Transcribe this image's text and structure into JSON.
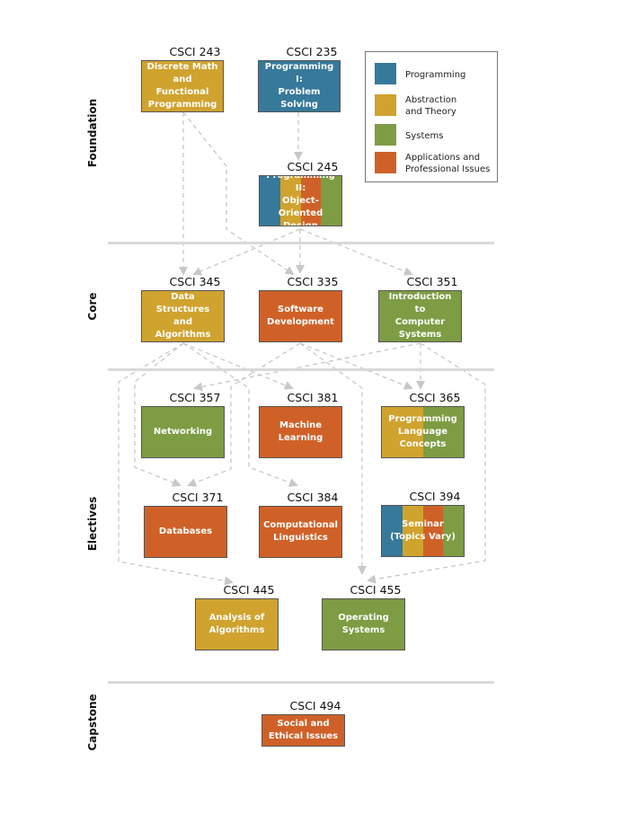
{
  "colors": {
    "programming": "#36799a",
    "abstraction": "#d0a32f",
    "systems": "#7d9c43",
    "applications": "#cf6128",
    "arrow": "#c8c8c8",
    "divider": "#d9d9d9"
  },
  "legend": [
    {
      "category": "programming",
      "label": "Programming"
    },
    {
      "category": "abstraction",
      "label": "Abstraction\nand Theory"
    },
    {
      "category": "systems",
      "label": "Systems"
    },
    {
      "category": "applications",
      "label": "Applications and\nProfessional Issues"
    }
  ],
  "sections": [
    {
      "id": "foundation",
      "label": "Foundation"
    },
    {
      "id": "core",
      "label": "Core"
    },
    {
      "id": "electives",
      "label": "Electives"
    },
    {
      "id": "capstone",
      "label": "Capstone"
    }
  ],
  "courses": [
    {
      "id": "243",
      "code": "CSCI 243",
      "title": "Discrete Math\nand Functional\nProgramming",
      "categories": [
        "abstraction"
      ],
      "section": "foundation"
    },
    {
      "id": "235",
      "code": "CSCI 235",
      "title": "Programming I:\nProblem Solving",
      "categories": [
        "programming"
      ],
      "section": "foundation"
    },
    {
      "id": "245",
      "code": "CSCI  245",
      "title": "Programming II:\nObject-Oriented\nDesign",
      "categories": [
        "programming",
        "abstraction",
        "applications",
        "systems"
      ],
      "section": "foundation"
    },
    {
      "id": "345",
      "code": "CSCI 345",
      "title": "Data Structures\nand\nAlgorithms",
      "categories": [
        "abstraction"
      ],
      "section": "core"
    },
    {
      "id": "335",
      "code": "CSCI 335",
      "title": "Software\nDevelopment",
      "categories": [
        "applications"
      ],
      "section": "core"
    },
    {
      "id": "351",
      "code": "CSCI 351",
      "title": "Introduction to\nComputer\nSystems",
      "categories": [
        "systems"
      ],
      "section": "core"
    },
    {
      "id": "357",
      "code": "CSCI 357",
      "title": "Networking",
      "categories": [
        "systems"
      ],
      "section": "electives"
    },
    {
      "id": "381",
      "code": "CSCI 381",
      "title": "Machine\nLearning",
      "categories": [
        "applications"
      ],
      "section": "electives"
    },
    {
      "id": "365",
      "code": "CSCI 365",
      "title": "Programming\nLanguage\nConcepts",
      "categories": [
        "abstraction",
        "systems"
      ],
      "section": "electives"
    },
    {
      "id": "371",
      "code": "CSCI 371",
      "title": "Databases",
      "categories": [
        "applications"
      ],
      "section": "electives"
    },
    {
      "id": "384",
      "code": "CSCI 384",
      "title": "Computational\nLinguistics",
      "categories": [
        "applications"
      ],
      "section": "electives"
    },
    {
      "id": "394",
      "code": "CSCI 394",
      "title": "Seminar\n(Topics Vary)",
      "categories": [
        "programming",
        "abstraction",
        "applications",
        "systems"
      ],
      "section": "electives"
    },
    {
      "id": "445",
      "code": "CSCI 445",
      "title": "Analysis of\nAlgorithms",
      "categories": [
        "abstraction"
      ],
      "section": "electives"
    },
    {
      "id": "455",
      "code": "CSCI 455",
      "title": "Operating\nSystems",
      "categories": [
        "systems"
      ],
      "section": "electives"
    },
    {
      "id": "494",
      "code": "CSCI 494",
      "title": "Social and\nEthical Issues",
      "categories": [
        "applications"
      ],
      "section": "capstone"
    }
  ],
  "prerequisites": [
    {
      "from": "235",
      "to": "245"
    },
    {
      "from": "243",
      "to": "345"
    },
    {
      "from": "243",
      "to": "335"
    },
    {
      "from": "245",
      "to": "345"
    },
    {
      "from": "245",
      "to": "335"
    },
    {
      "from": "245",
      "to": "351"
    },
    {
      "from": "345",
      "to": "381"
    },
    {
      "from": "345",
      "to": "371"
    },
    {
      "from": "345",
      "to": "384"
    },
    {
      "from": "345",
      "to": "445"
    },
    {
      "from": "335",
      "to": "365"
    },
    {
      "from": "335",
      "to": "371"
    },
    {
      "from": "335",
      "to": "455"
    },
    {
      "from": "351",
      "to": "357"
    },
    {
      "from": "351",
      "to": "365"
    },
    {
      "from": "351",
      "to": "455"
    }
  ]
}
